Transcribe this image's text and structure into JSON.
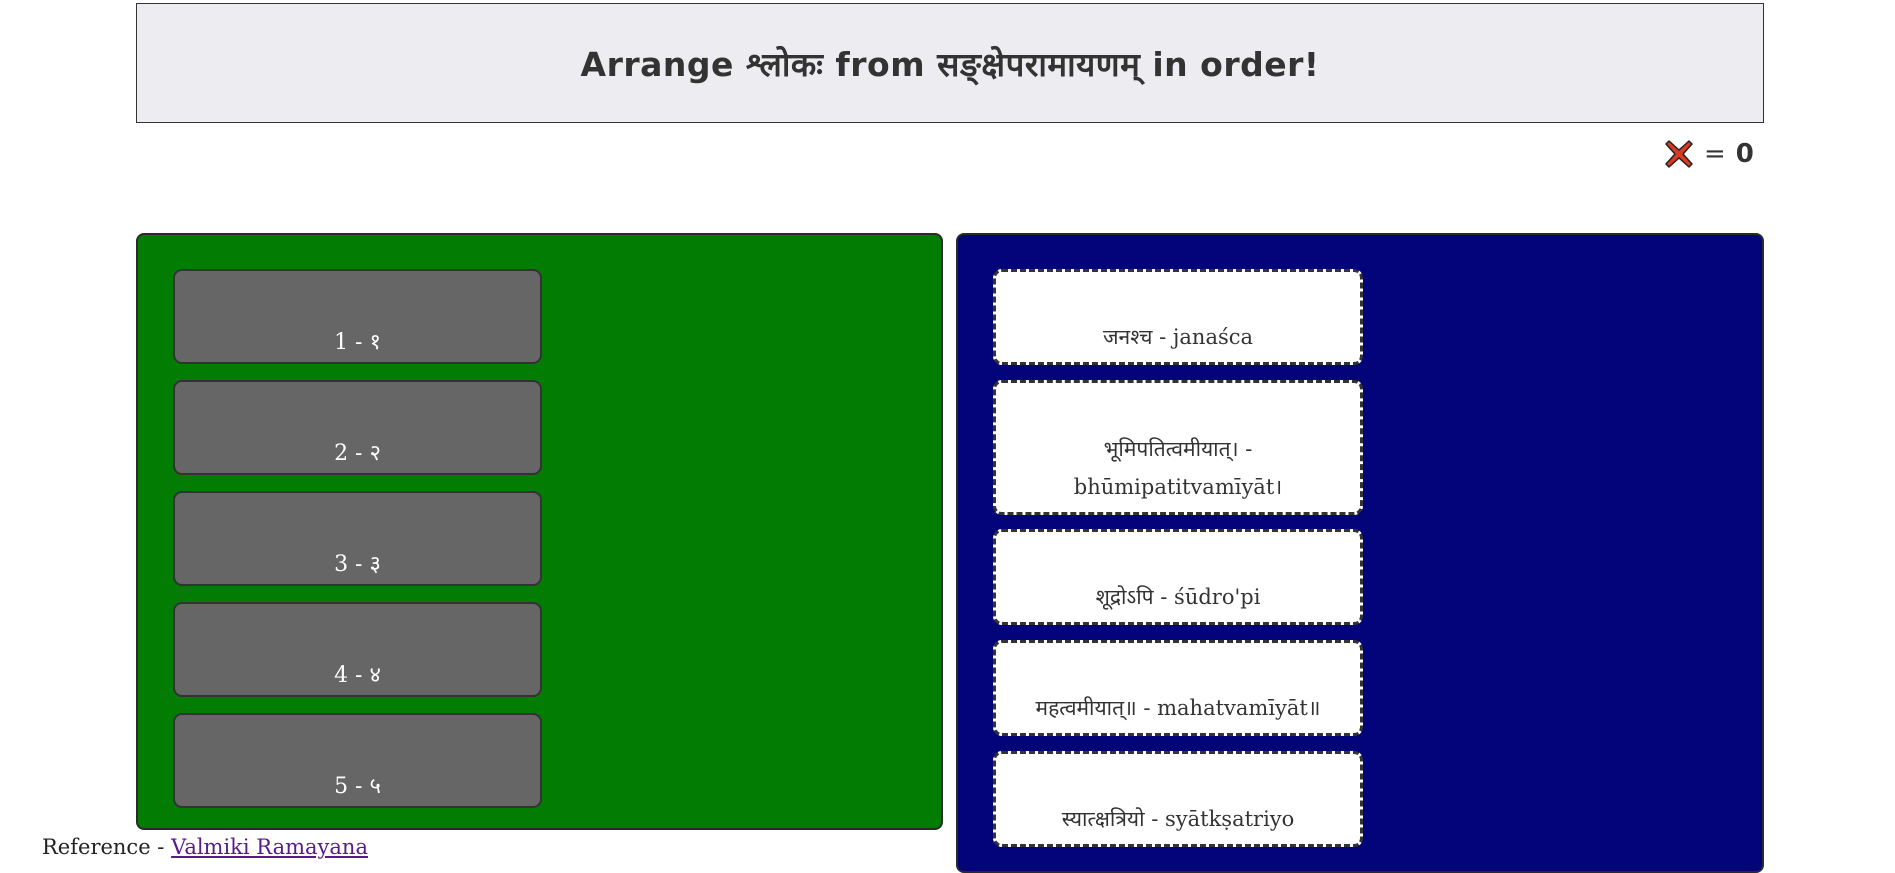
{
  "header": {
    "title": "Arrange श्लोकः from सङ्क्षेपरामायणम् in order!"
  },
  "score": {
    "icon": "close-x-icon",
    "icon_color": "#d93a22",
    "equals": "=",
    "value": "0"
  },
  "left_panel": {
    "color": "#027c02",
    "slots": [
      {
        "label": "1 - १"
      },
      {
        "label": "2 - २"
      },
      {
        "label": "3 - ३"
      },
      {
        "label": "4 - ४"
      },
      {
        "label": "5 - ५"
      }
    ]
  },
  "right_panel": {
    "color": "#03037a",
    "cards": [
      {
        "text": "जनश्च - janaśca"
      },
      {
        "text": "भूमिपतित्वमीयात्। - bhūmipatitvamīyāt।"
      },
      {
        "text": "शूद्रोऽपि - śūdro'pi"
      },
      {
        "text": "महत्वमीयात्॥ - mahatvamīyāt॥"
      },
      {
        "text": "स्यात्क्षत्रियो - syātkṣatriyo"
      }
    ]
  },
  "footer": {
    "prefix": "Reference - ",
    "link": "Valmiki Ramayana"
  }
}
